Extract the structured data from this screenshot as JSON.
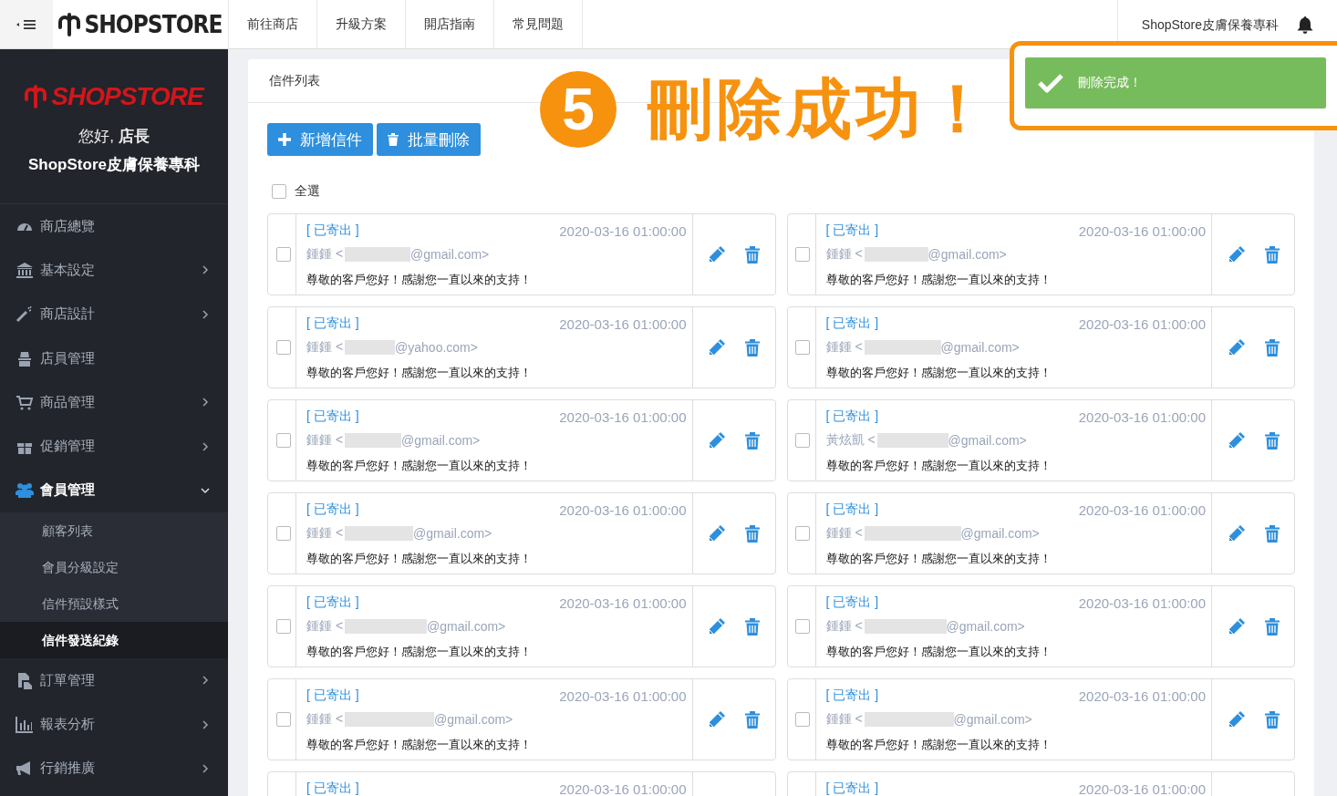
{
  "topbar": {
    "logo": "SHOPSTORE",
    "nav": [
      "前往商店",
      "升級方案",
      "開店指南",
      "常見問題"
    ],
    "store_name": "ShopStore皮膚保養專科"
  },
  "sidebar": {
    "logo": "SHOPSTORE",
    "greeting": "您好,",
    "role": "店長",
    "store": "ShopStore皮膚保養專科",
    "items": [
      {
        "label": "商店總覽",
        "has_submenu": false,
        "expanded": false
      },
      {
        "label": "基本設定",
        "has_submenu": true,
        "expanded": false
      },
      {
        "label": "商店設計",
        "has_submenu": true,
        "expanded": false
      },
      {
        "label": "店員管理",
        "has_submenu": false,
        "expanded": false
      },
      {
        "label": "商品管理",
        "has_submenu": true,
        "expanded": false
      },
      {
        "label": "促銷管理",
        "has_submenu": true,
        "expanded": false
      },
      {
        "label": "會員管理",
        "has_submenu": true,
        "expanded": true,
        "children": [
          {
            "label": "顧客列表",
            "selected": false
          },
          {
            "label": "會員分級設定",
            "selected": false
          },
          {
            "label": "信件預設樣式",
            "selected": false
          },
          {
            "label": "信件發送紀錄",
            "selected": true
          }
        ]
      },
      {
        "label": "訂單管理",
        "has_submenu": true,
        "expanded": false
      },
      {
        "label": "報表分析",
        "has_submenu": true,
        "expanded": false
      },
      {
        "label": "行銷推廣",
        "has_submenu": true,
        "expanded": false
      }
    ]
  },
  "panel": {
    "title": "信件列表",
    "buttons": [
      {
        "kind": "add",
        "label": "新增信件"
      },
      {
        "kind": "delete",
        "label": "批量刪除"
      }
    ],
    "select_all": {
      "label": "全選",
      "checked": false
    },
    "letters": [
      {
        "status": "[ 已寄出 ]",
        "date": "2020-03-16 01:00:00",
        "sender": "鍾鍾 <",
        "address": "@gmail.com>",
        "message": "尊敬的客戶您好！感謝您一直以來的支持！",
        "checked": false
      },
      {
        "status": "[ 已寄出 ]",
        "date": "2020-03-16 01:00:00",
        "sender": "鍾鍾 <",
        "address": "@gmail.com>",
        "message": "尊敬的客戶您好！感謝您一直以來的支持！",
        "checked": false
      },
      {
        "status": "[ 已寄出 ]",
        "date": "2020-03-16 01:00:00",
        "sender": "鍾鍾 <",
        "address": "@yahoo.com>",
        "message": "尊敬的客戶您好！感謝您一直以來的支持！",
        "checked": false
      },
      {
        "status": "[ 已寄出 ]",
        "date": "2020-03-16 01:00:00",
        "sender": "鍾鍾 <",
        "address": "@gmail.com>",
        "message": "尊敬的客戶您好！感謝您一直以來的支持！",
        "checked": false
      },
      {
        "status": "[ 已寄出 ]",
        "date": "2020-03-16 01:00:00",
        "sender": "鍾鍾 <",
        "address": "@gmail.com>",
        "message": "尊敬的客戶您好！感謝您一直以來的支持！",
        "checked": false
      },
      {
        "status": "[ 已寄出 ]",
        "date": "2020-03-16 01:00:00",
        "sender": "黃炫凱 <",
        "address": "@gmail.com>",
        "message": "尊敬的客戶您好！感謝您一直以來的支持！",
        "checked": false
      },
      {
        "status": "[ 已寄出 ]",
        "date": "2020-03-16 01:00:00",
        "sender": "鍾鍾 <",
        "address": "@gmail.com>",
        "message": "尊敬的客戶您好！感謝您一直以來的支持！",
        "checked": false
      },
      {
        "status": "[ 已寄出 ]",
        "date": "2020-03-16 01:00:00",
        "sender": "鍾鍾 <",
        "address": "@gmail.com>",
        "message": "尊敬的客戶您好！感謝您一直以來的支持！",
        "checked": false
      },
      {
        "status": "[ 已寄出 ]",
        "date": "2020-03-16 01:00:00",
        "sender": "鍾鍾 <",
        "address": "@gmail.com>",
        "message": "尊敬的客戶您好！感謝您一直以來的支持！",
        "checked": false
      },
      {
        "status": "[ 已寄出 ]",
        "date": "2020-03-16 01:00:00",
        "sender": "鍾鍾 <",
        "address": "@gmail.com>",
        "message": "尊敬的客戶您好！感謝您一直以來的支持！",
        "checked": false
      },
      {
        "status": "[ 已寄出 ]",
        "date": "2020-03-16 01:00:00",
        "sender": "鍾鍾 <",
        "address": "@gmail.com>",
        "message": "尊敬的客戶您好！感謝您一直以來的支持！",
        "checked": false
      },
      {
        "status": "[ 已寄出 ]",
        "date": "2020-03-16 01:00:00",
        "sender": "鍾鍾 <",
        "address": "@gmail.com>",
        "message": "尊敬的客戶您好！感謝您一直以來的支持！",
        "checked": false
      },
      {
        "status": "[ 已寄出 ]",
        "date": "2020-03-16 01:00:00"
      },
      {
        "status": "[ 已寄出 ]",
        "date": "2020-03-16 01:00:00"
      }
    ]
  },
  "toast": {
    "message": "刪除完成！"
  },
  "annotation": {
    "step": "5",
    "text": "刪除成功！"
  }
}
